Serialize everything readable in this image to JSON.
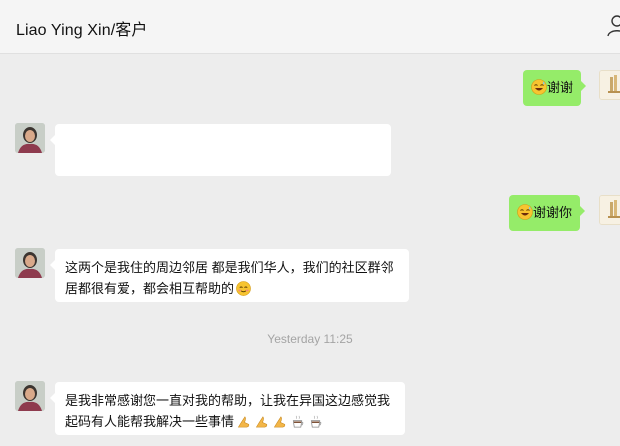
{
  "header": {
    "title": "Liao Ying Xin/客户"
  },
  "messages": [
    {
      "direction": "out",
      "text": "谢谢",
      "emoji": "grinning-sweat-emoji"
    },
    {
      "direction": "in",
      "text": "",
      "note": "blank image/card"
    },
    {
      "direction": "out",
      "text": "谢谢你",
      "emoji": "grinning-sweat-emoji"
    },
    {
      "direction": "in",
      "line1": "这两个是我住的周边邻居 都是我们华人，我们的社区群邻",
      "line2": "居都很有爱，都会相互帮助的"
    },
    {
      "direction": "in",
      "line1": "是我非常感谢您一直对我的帮助，让我在异国这边感觉我",
      "line2": "起码有人能帮我解决一些事情"
    }
  ],
  "timestamp": "Yesterday 11:25",
  "colors": {
    "outgoing_bubble": "#95ec69",
    "incoming_bubble": "#ffffff",
    "background": "#ededed",
    "timestamp_text": "#a4a4a4"
  }
}
